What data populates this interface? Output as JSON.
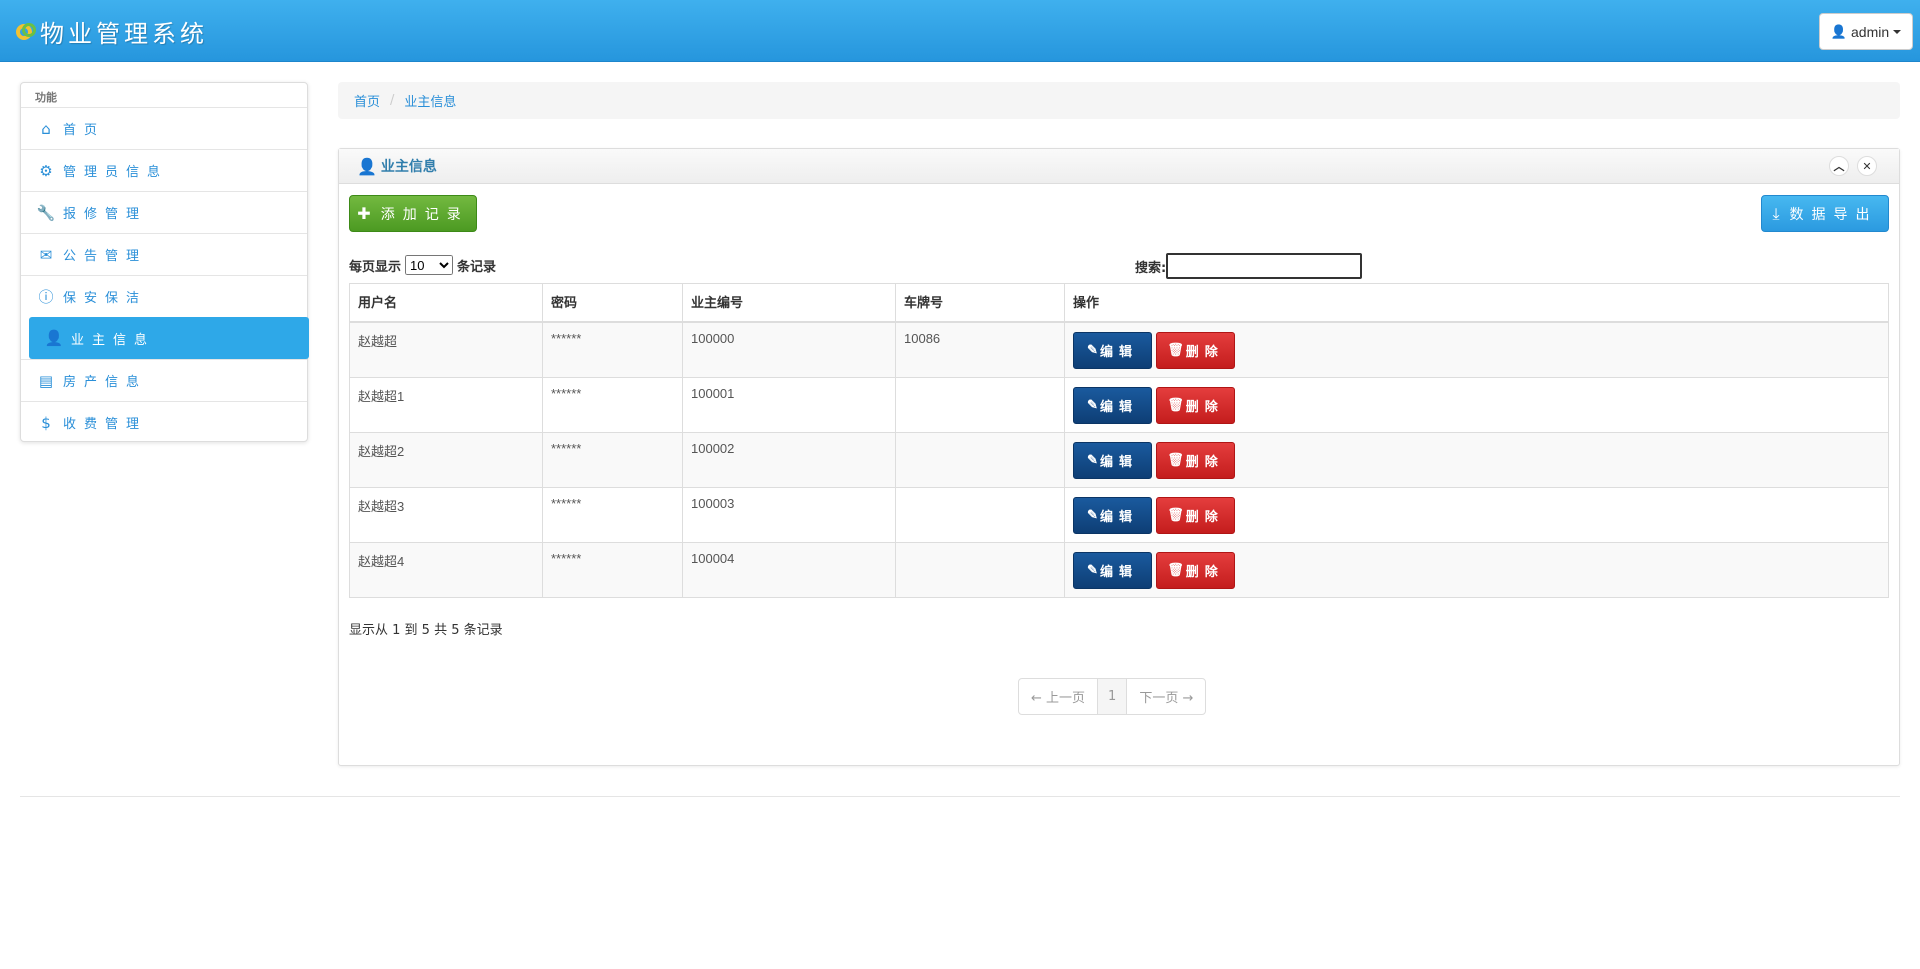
{
  "app": {
    "title": "物业管理系统",
    "user": "admin"
  },
  "sidebar": {
    "header": "功能",
    "items": [
      {
        "label": "首页",
        "icon": "home-icon"
      },
      {
        "label": "管理员信息",
        "icon": "gear-icon"
      },
      {
        "label": "报修管理",
        "icon": "wrench-icon"
      },
      {
        "label": "公告管理",
        "icon": "envelope-icon"
      },
      {
        "label": "保安保洁",
        "icon": "info-icon"
      },
      {
        "label": "业主信息",
        "icon": "user-icon",
        "active": true
      },
      {
        "label": "房产信息",
        "icon": "list-icon"
      },
      {
        "label": "收费管理",
        "icon": "dollar-icon"
      }
    ]
  },
  "breadcrumb": {
    "home": "首页",
    "current": "业主信息"
  },
  "panel": {
    "title": "业主信息",
    "add_label": "添加记录",
    "export_label": "数据导出",
    "length_prefix": "每页显示",
    "length_value": "10",
    "length_suffix": "条记录",
    "search_label": "搜索:",
    "search_value": ""
  },
  "table": {
    "headers": [
      "用户名",
      "密码",
      "业主编号",
      "车牌号",
      "操作"
    ],
    "rows": [
      {
        "username": "赵越超",
        "password": "******",
        "owner_id": "100000",
        "plate": "10086"
      },
      {
        "username": "赵越超1",
        "password": "******",
        "owner_id": "100001",
        "plate": ""
      },
      {
        "username": "赵越超2",
        "password": "******",
        "owner_id": "100002",
        "plate": ""
      },
      {
        "username": "赵越超3",
        "password": "******",
        "owner_id": "100003",
        "plate": ""
      },
      {
        "username": "赵越超4",
        "password": "******",
        "owner_id": "100004",
        "plate": ""
      }
    ],
    "edit_label": "编辑",
    "delete_label": "删除"
  },
  "info": "显示从 1 到 5 共 5 条记录",
  "pager": {
    "prev": "← 上一页",
    "page": "1",
    "next": "下一页 →"
  },
  "colors": {
    "accent": "#2ea8e8",
    "add": "#4c9a22",
    "edit": "#0e3e75",
    "delete": "#c41d1d"
  }
}
